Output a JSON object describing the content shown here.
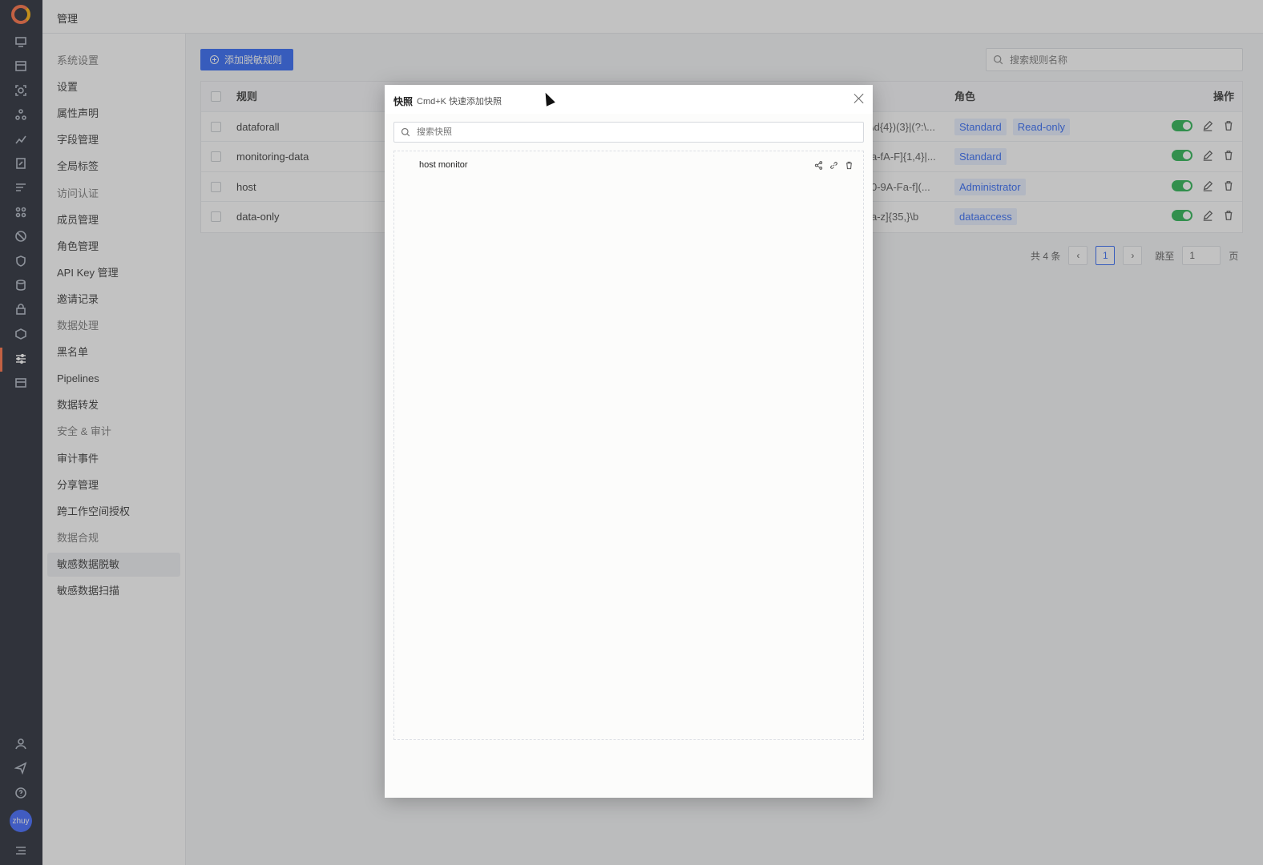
{
  "header": {
    "title": "管理"
  },
  "nav": {
    "items": [
      {
        "label": "系统设置",
        "type": "group"
      },
      {
        "label": "设置",
        "type": "item"
      },
      {
        "label": "属性声明",
        "type": "item"
      },
      {
        "label": "字段管理",
        "type": "item"
      },
      {
        "label": "全局标签",
        "type": "item"
      },
      {
        "label": "访问认证",
        "type": "group"
      },
      {
        "label": "成员管理",
        "type": "item"
      },
      {
        "label": "角色管理",
        "type": "item"
      },
      {
        "label": "API Key 管理",
        "type": "item"
      },
      {
        "label": "邀请记录",
        "type": "item"
      },
      {
        "label": "数据处理",
        "type": "group"
      },
      {
        "label": "黑名单",
        "type": "item"
      },
      {
        "label": "Pipelines",
        "type": "item"
      },
      {
        "label": "数据转发",
        "type": "item"
      },
      {
        "label": "安全 & 审计",
        "type": "group"
      },
      {
        "label": "审计事件",
        "type": "item"
      },
      {
        "label": "分享管理",
        "type": "item"
      },
      {
        "label": "跨工作空间授权",
        "type": "item"
      },
      {
        "label": "数据合规",
        "type": "group"
      },
      {
        "label": "敏感数据脱敏",
        "type": "active"
      },
      {
        "label": "敏感数据扫描",
        "type": "item"
      }
    ]
  },
  "toolbar": {
    "add_label": "添加脱敏规则",
    "search_placeholder": "搜索规则名称"
  },
  "table": {
    "headers": {
      "rule": "规则",
      "role": "角色",
      "ops": "操作"
    },
    "rows": [
      {
        "name": "dataforall",
        "regex": "\\d{4})(3}|(?:\\...",
        "roles": [
          "Standard",
          "Read-only"
        ]
      },
      {
        "name": "monitoring-data",
        "regex": "a-fA-F]{1,4}|...",
        "roles": [
          "Standard"
        ]
      },
      {
        "name": "host",
        "regex": "0-9A-Fa-f](...",
        "roles": [
          "Administrator"
        ]
      },
      {
        "name": "data-only",
        "regex": "a-z]{35,}\\b",
        "roles": [
          "dataaccess"
        ]
      }
    ]
  },
  "pager": {
    "total": "共 4 条",
    "current": "1",
    "jump_label": "跳至",
    "jump_value": "1",
    "page_suffix": "页"
  },
  "modal": {
    "title": "快照",
    "hint": "Cmd+K 快速添加快照",
    "search_placeholder": "搜索快照",
    "items": [
      {
        "label": "host monitor"
      }
    ]
  },
  "user": {
    "avatar": "zhuy"
  },
  "colors": {
    "accent": "#2a63f6",
    "brand": "#ff6a3d",
    "toggle_on": "#22b14c"
  }
}
